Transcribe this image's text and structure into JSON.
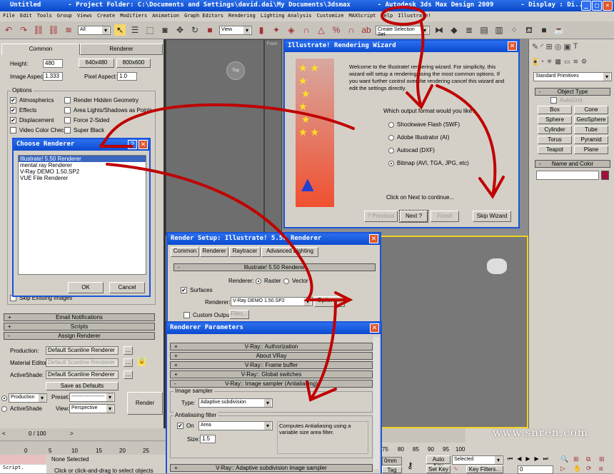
{
  "title": "Untitled       - Project Folder: C:\\Documents and Settings\\david.dai\\My Documents\\3dsmax       - Autodesk 3ds Max Design 2009       - Display : Di...",
  "menu": [
    "File",
    "Edit",
    "Tools",
    "Group",
    "Views",
    "Create",
    "Modifiers",
    "Animation",
    "Graph Editors",
    "Rendering",
    "Lighting Analysis",
    "Customize",
    "MAXScript",
    "Help",
    "Illustrate!"
  ],
  "toolbar": {
    "filter": "All",
    "ref_coord": "View",
    "selection_set": "Create Selection Set"
  },
  "render_setup_main": {
    "tabs": [
      "Common",
      "Renderer"
    ],
    "height_label": "Height:",
    "height": "480",
    "preset1": "640x480",
    "preset2": "800x600",
    "aspect_label": "Image Aspect:",
    "aspect": "1.333",
    "pixel_label": "Pixel Aspect:",
    "pixel": "1.0",
    "options_title": "Options",
    "options_left": [
      {
        "label": "Atmospherics",
        "checked": true
      },
      {
        "label": "Effects",
        "checked": true
      },
      {
        "label": "Displacement",
        "checked": true
      },
      {
        "label": "Video Color Check",
        "checked": false
      }
    ],
    "options_right": [
      {
        "label": "Render Hidden Geometry"
      },
      {
        "label": "Area Lights/Shadows as Points"
      },
      {
        "label": "Force 2-Sided"
      },
      {
        "label": "Super Black"
      }
    ],
    "skip_existing": "Skip Existing Images",
    "rollouts": [
      "Email Notifications",
      "Scripts",
      "Assign Renderer"
    ],
    "production_label": "Production:",
    "production": "Default Scanline Renderer",
    "mated_label": "Material Editor:",
    "mated": "Default Scanline Renderer",
    "activeshade_label": "ActiveShade:",
    "activeshade": "Default Scanline Renderer",
    "save_defaults": "Save as Defaults",
    "mode_production": "Production",
    "mode_activeshade": "ActiveShade",
    "preset_label": "Preset:",
    "preset": "--------------------",
    "view_label": "View:",
    "view": "Perspective",
    "render": "Render"
  },
  "choose_renderer": {
    "title": "Choose Renderer",
    "items": [
      "Illustrate! 5.50  Renderer",
      "mental ray Renderer",
      "V-Ray DEMO 1.50.SP2",
      "VUE File Renderer"
    ],
    "ok": "OK",
    "cancel": "Cancel"
  },
  "wizard": {
    "title": "Illustrate! Rendering Wizard",
    "intro": "Welcome to the Illustrate! rendering wizard. For simplicity, this wizard will setup a rendering using the most common options. If you want further control over the rendering cancel this wizard and edit the settings directly.",
    "question": "Which output format would you like?",
    "options": [
      "Shockwave Flash (SWF)",
      "Adobe Illustrator (AI)",
      "Autocad (DXF)",
      "Bitmap (AVI, TGA, JPG, etc)"
    ],
    "selected": 3,
    "continue": "Click on Next to continue...",
    "prev": "? Previous",
    "next": "Next ?",
    "finish": "Finish",
    "skip": "Skip Wizard"
  },
  "illustrate_setup": {
    "title": "Render Setup: Illustrate! 5.50  Renderer",
    "tabs": [
      "Common",
      "Renderer",
      "Raytracer",
      "Advanced Lighting"
    ],
    "rollout": "Illustrate! 5.50  Renderer",
    "renderer_label": "Renderer:",
    "raster": "Raster",
    "vector": "Vector",
    "surfaces": "Surfaces",
    "surf_renderer_label": "Renderer:",
    "surf_renderer": "V-Ray DEMO 1.50.SP2",
    "options": "Options...",
    "custom_output": "Custom Output:",
    "files": "Files..."
  },
  "renderer_params": {
    "title": "Renderer Parameters",
    "rollouts": [
      "V-Ray:: Authorization",
      "About VRay",
      "V-Ray:: Frame buffer",
      "V-Ray:: Global switches",
      "V-Ray:: Image sampler (Antialiasing)"
    ],
    "image_sampler": "Image sampler",
    "type_label": "Type:",
    "type": "Adaptive subdivision",
    "aa_filter": "Antialiasing filter",
    "on": "On",
    "filter": "Area",
    "filter_desc": "Computes Antialiasing using a variable size area filter.",
    "size_label": "Size:",
    "size": "1.5",
    "bottom_rollout": "V-Ray:: Adaptive subdivision image sampler"
  },
  "command_panel": {
    "category": "Standard Primitives",
    "object_type": "Object Type",
    "autogrid": "AutoGrid",
    "buttons": [
      "Box",
      "Cone",
      "Sphere",
      "GeoSphere",
      "Cylinder",
      "Tube",
      "Torus",
      "Pyramid",
      "Teapot",
      "Plane"
    ],
    "name_color": "Name and Color",
    "object_color": "#a0103a"
  },
  "viewports": {
    "top": "Top",
    "front": "Front"
  },
  "timeline": {
    "frame": "0 / 100",
    "ticks_left": [
      "0",
      "5",
      "10",
      "15",
      "20",
      "25"
    ],
    "ticks_right": [
      "75",
      "80",
      "85",
      "90",
      "95",
      "100"
    ]
  },
  "status": {
    "script": "Script.",
    "selection": "None Selected",
    "prompt": "Click or click-and-drag to select objects",
    "unit": "0mm",
    "tag": "Tag",
    "auto_key": "Auto Key",
    "set_key": "Set Key",
    "key_mode": "Selected",
    "key_filters": "Key Filters...",
    "frame": "0"
  },
  "watermark": "www.snren.com",
  "annotation_color": "#c00000"
}
